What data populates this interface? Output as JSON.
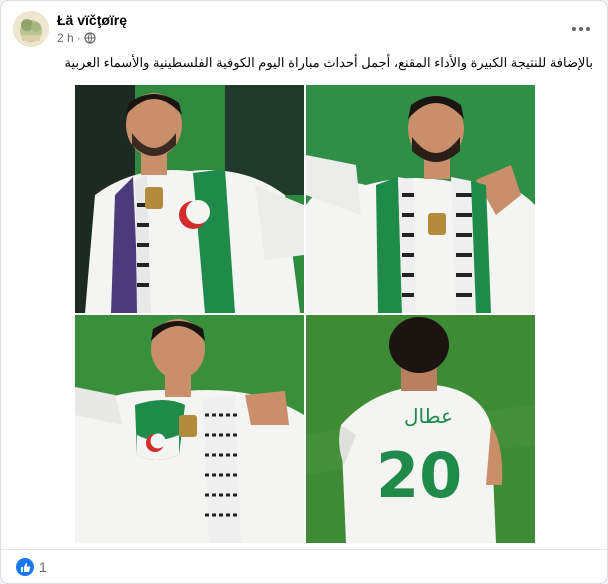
{
  "post": {
    "author": "Łä vïčţøïrę",
    "time": "2 h",
    "separator": "·",
    "audience_icon": "globe-icon",
    "more_icon": "more-horizontal-icon",
    "text": "بالإضافة للنتيجة الكبيرة والأداء المقنع، أجمل أحداث مباراة اليوم الكوفية الفلسطينية والأسماء العربية"
  },
  "photos": [
    {
      "scene": "player in white jersey wearing Palestinian keffiyeh scarf, stadium background"
    },
    {
      "scene": "player in white jersey with keffiyeh scarf, hand on shoulder, green background"
    },
    {
      "scene": "player in white jersey with Algeria flag scarf and keffiyeh, green pitch background"
    },
    {
      "scene": "player seen from behind wearing number 20 jersey with Arabic name",
      "jersey_name": "عطال",
      "jersey_number": "20"
    }
  ],
  "reactions": {
    "icon": "like-icon",
    "count": "1"
  },
  "colors": {
    "like_blue": "#1877f2",
    "pitch_green": "#2f8a3f",
    "jersey_white": "#f4f4f2",
    "jersey_green": "#1f8a4a"
  }
}
